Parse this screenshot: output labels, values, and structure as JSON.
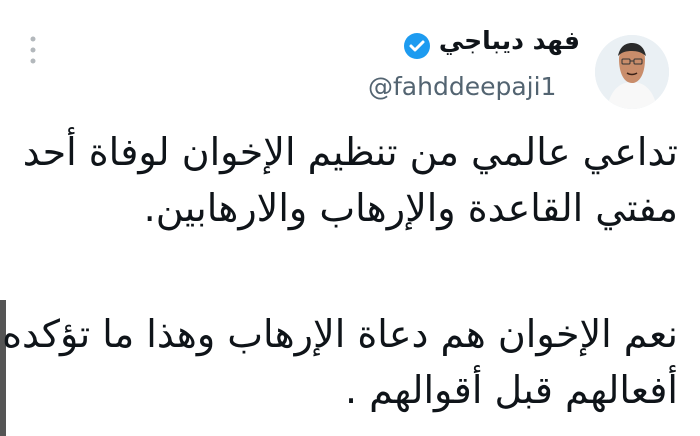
{
  "author": {
    "name": "فهد ديباجي",
    "handle": "@fahddeepaji1",
    "verified": true,
    "avatar": "profile-photo"
  },
  "menu": {
    "icon": "more-vertical-icon"
  },
  "tweet": {
    "lines": [
      "تداعي عالمي من تنظيم الإخوان لوفاة أحد",
      "مفتي القاعدة والإرهاب والارهابين.",
      "نعم الإخوان هم دعاة الإرهاب وهذا ما تؤكده",
      "أفعالهم قبل أقوالهم ."
    ]
  },
  "colors": {
    "text": "#0f1419",
    "secondary": "#536471",
    "verified": "#1d9bf0"
  }
}
